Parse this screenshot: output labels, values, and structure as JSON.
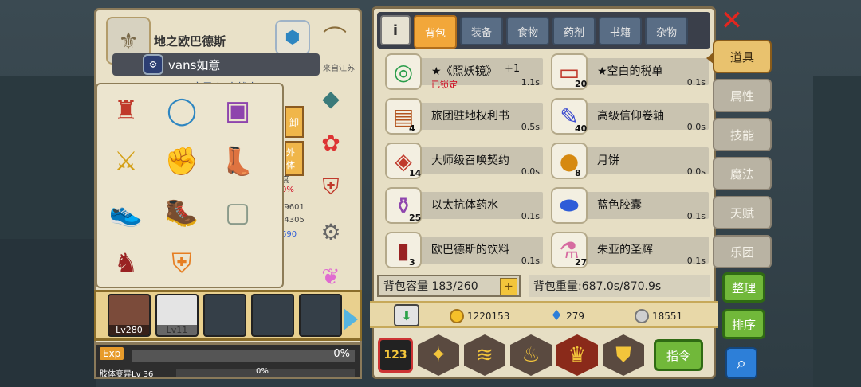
{
  "character": {
    "title": "地之欧巴德斯",
    "player_name": "vans如意",
    "from": "来自江苏",
    "job": "变异人·魔战士",
    "side_tabs": [
      "卸",
      "外体"
    ],
    "side_stats": [
      "度",
      "0%",
      "/9601",
      "/4305",
      "690"
    ]
  },
  "party": {
    "slots": [
      {
        "level": "Lv280"
      },
      {
        "level": "Lv11"
      },
      {
        "level": ""
      },
      {
        "level": ""
      },
      {
        "level": ""
      }
    ]
  },
  "exp": {
    "label": "Exp",
    "percent": "0%",
    "sub_label": "肢体变异Lv 36",
    "sub_percent": "0%"
  },
  "tabs": {
    "items": [
      "背包",
      "装备",
      "食物",
      "药剂",
      "书籍",
      "杂物"
    ],
    "active": "背包"
  },
  "inventory": {
    "items": [
      {
        "name": "★《照妖镜》",
        "plus": "+1",
        "time": "1.1s",
        "lock": "已锁定",
        "count": "",
        "icon": "mirror-icon",
        "glyph": "🪞"
      },
      {
        "name": "★空白的税单",
        "time": "0.1s",
        "count": "20",
        "icon": "tax-form-icon",
        "glyph": "📜"
      },
      {
        "name": "旅团驻地权利书",
        "time": "0.5s",
        "count": "4",
        "icon": "book-icon",
        "glyph": "📕"
      },
      {
        "name": "高级信仰卷轴",
        "time": "0.0s",
        "count": "40",
        "icon": "scroll-icon",
        "glyph": "🪄"
      },
      {
        "name": "大师级召唤契约",
        "time": "0.0s",
        "count": "14",
        "icon": "contract-icon",
        "glyph": "📄"
      },
      {
        "name": "月饼",
        "time": "0.0s",
        "count": "8",
        "icon": "mooncake-icon",
        "glyph": "🥮"
      },
      {
        "name": "以太抗体药水",
        "time": "0.1s",
        "count": "25",
        "icon": "potion-icon",
        "glyph": "🧪"
      },
      {
        "name": "蓝色胶囊",
        "time": "0.1s",
        "count": "",
        "icon": "capsule-icon",
        "glyph": "💊"
      },
      {
        "name": "欧巴德斯的饮料",
        "time": "0.1s",
        "count": "3",
        "icon": "drink-icon",
        "glyph": "🍾"
      },
      {
        "name": "朱亚的圣辉",
        "time": "0.1s",
        "count": "27",
        "icon": "holy-potion-icon",
        "glyph": "⚗"
      }
    ],
    "capacity_label": "背包容量 183/260",
    "weight_label": "背包重量:687.0s/870.9s"
  },
  "currency": {
    "gold": "1220153",
    "diamond": "279",
    "silver": "18551"
  },
  "actions": {
    "command": "指令",
    "sort_arrange": "整理",
    "sort_order": "排序"
  },
  "side_nav": {
    "items": [
      "道具",
      "属性",
      "技能",
      "魔法",
      "天赋",
      "乐团"
    ],
    "active": "道具"
  },
  "colors": {
    "active_tab": "#f2a73a",
    "green_button": "#71b83a",
    "lock_red": "#d0021b",
    "close_red": "#e2261f"
  }
}
